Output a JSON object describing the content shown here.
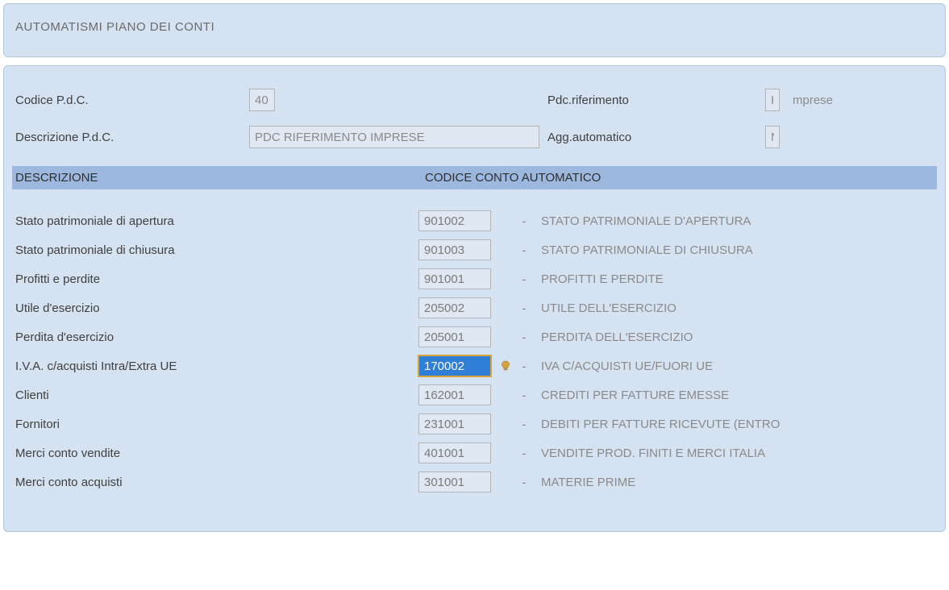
{
  "title": "AUTOMATISMI PIANO DEI CONTI",
  "form": {
    "codice_label": "Codice P.d.C.",
    "codice_value": "40",
    "descrizione_label": "Descrizione P.d.C.",
    "descrizione_value": "PDC RIFERIMENTO IMPRESE",
    "pdcrif_label": "Pdc.riferimento",
    "pdcrif_code": "I",
    "pdcrif_text": "mprese",
    "aggauto_label": "Agg.automatico",
    "aggauto_value": "N"
  },
  "header": {
    "col1": "DESCRIZIONE",
    "col2": "CODICE CONTO AUTOMATICO"
  },
  "rows": [
    {
      "desc": "Stato patrimoniale di apertura",
      "code": "901002",
      "long": "STATO PATRIMONIALE D'APERTURA",
      "active": false
    },
    {
      "desc": "Stato patrimoniale di chiusura",
      "code": "901003",
      "long": "STATO PATRIMONIALE DI CHIUSURA",
      "active": false
    },
    {
      "desc": "Profitti e perdite",
      "code": "901001",
      "long": "PROFITTI E PERDITE",
      "active": false
    },
    {
      "desc": "Utile d'esercizio",
      "code": "205002",
      "long": "UTILE DELL'ESERCIZIO",
      "active": false
    },
    {
      "desc": "Perdita d'esercizio",
      "code": "205001",
      "long": "PERDITA DELL'ESERCIZIO",
      "active": false
    },
    {
      "desc": "I.V.A. c/acquisti Intra/Extra UE",
      "code": "170002",
      "long": "IVA C/ACQUISTI UE/FUORI UE",
      "active": true
    },
    {
      "desc": "Clienti",
      "code": "162001",
      "long": "CREDITI PER FATTURE EMESSE",
      "active": false
    },
    {
      "desc": "Fornitori",
      "code": "231001",
      "long": "DEBITI PER FATTURE RICEVUTE (ENTRO",
      "active": false
    },
    {
      "desc": "Merci conto vendite",
      "code": "401001",
      "long": "VENDITE PROD. FINITI E MERCI ITALIA",
      "active": false
    },
    {
      "desc": "Merci conto acquisti",
      "code": "301001",
      "long": "MATERIE PRIME",
      "active": false
    }
  ],
  "dash": "-"
}
